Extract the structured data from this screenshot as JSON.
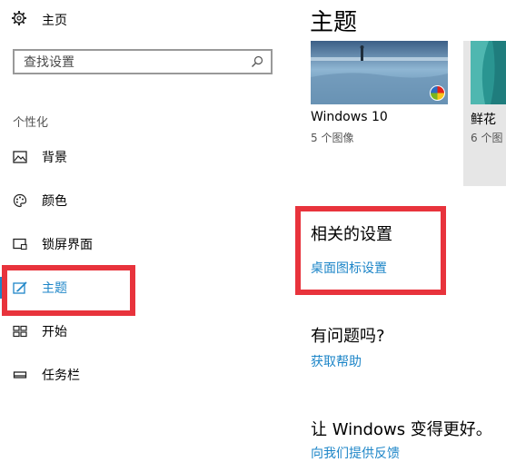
{
  "sidebar": {
    "home_label": "主页",
    "search_placeholder": "查找设置",
    "section_label": "个性化",
    "items": [
      {
        "label": "背景"
      },
      {
        "label": "颜色"
      },
      {
        "label": "锁屏界面"
      },
      {
        "label": "主题"
      },
      {
        "label": "开始"
      },
      {
        "label": "任务栏"
      }
    ],
    "selected_index": 3
  },
  "main": {
    "title": "主题",
    "themes": [
      {
        "name": "Windows 10",
        "count": "5 个图像"
      },
      {
        "name": "鲜花",
        "count": "6 个图"
      }
    ],
    "related": {
      "heading": "相关的设置",
      "link": "桌面图标设置"
    },
    "help": {
      "heading": "有问题吗?",
      "link": "获取帮助"
    },
    "feedback": {
      "heading": "让 Windows 变得更好。",
      "link": "向我们提供反馈"
    }
  },
  "colors": {
    "accent": "#1e86c8",
    "highlight_box": "#e8333c"
  }
}
